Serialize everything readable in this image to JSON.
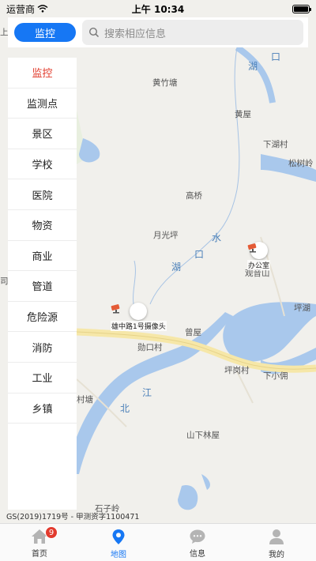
{
  "status_bar": {
    "carrier": "运营商",
    "time": "上午 10:34"
  },
  "top": {
    "monitor_label": "监控",
    "search_placeholder": "搜索相应信息"
  },
  "menu": [
    {
      "label": "监控",
      "active": true
    },
    {
      "label": "监测点"
    },
    {
      "label": "景区"
    },
    {
      "label": "学校"
    },
    {
      "label": "医院"
    },
    {
      "label": "物资"
    },
    {
      "label": "商业"
    },
    {
      "label": "管道"
    },
    {
      "label": "危险源"
    },
    {
      "label": "消防"
    },
    {
      "label": "工业"
    },
    {
      "label": "乡镇"
    }
  ],
  "map": {
    "places": [
      "黄竹塘",
      "黄屋",
      "下湖村",
      "松树岭",
      "高桥",
      "月光坪",
      "观音山",
      "坪湖",
      "曾屋",
      "勋口村",
      "坪岗村",
      "下小佣",
      "村塘",
      "山下林屋",
      "石子岭",
      "上",
      "司"
    ],
    "water": [
      "湖",
      "口",
      "水",
      "口",
      "湖",
      "江",
      "北"
    ],
    "pins": [
      {
        "caption": "雄中路1号摄像头"
      },
      {
        "caption": "办公室"
      }
    ],
    "copyright": "GS(2019)1719号 - 甲测资字1100471"
  },
  "tabs": [
    {
      "label": "首页",
      "icon": "home-icon",
      "badge": "9"
    },
    {
      "label": "地图",
      "icon": "map-pin-icon",
      "active": true
    },
    {
      "label": "信息",
      "icon": "message-icon"
    },
    {
      "label": "我的",
      "icon": "user-icon"
    }
  ],
  "colors": {
    "accent": "#1677f4",
    "active_menu": "#e13a2b",
    "badge": "#e23b2e",
    "water": "#a9c8ec",
    "road": "#f6e7a8"
  }
}
